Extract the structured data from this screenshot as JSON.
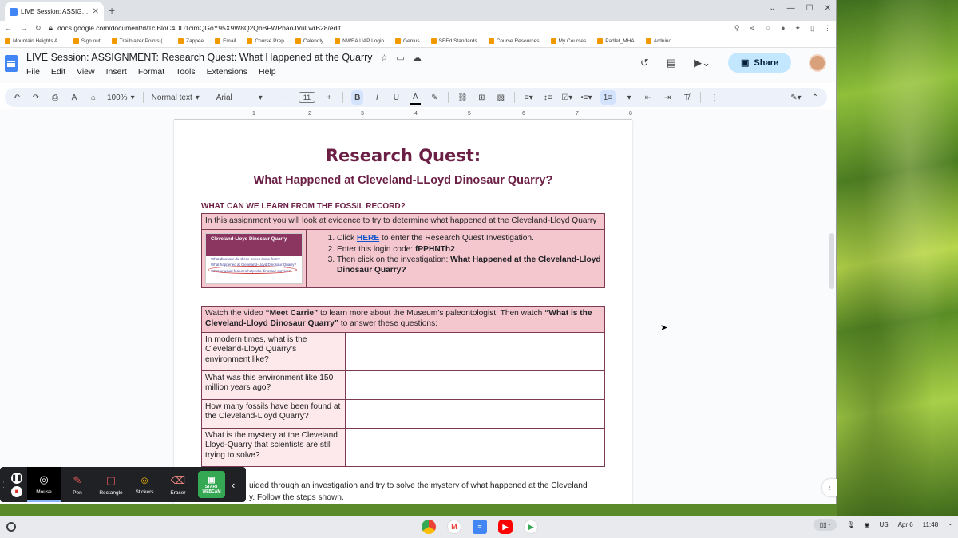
{
  "browser": {
    "tab_title": "LIVE Session: ASSIGNMENT: Re",
    "url": "docs.google.com/document/d/1ciBloC4DD1cimQGoY95X9W8Q2QbBFWPbaoJVuLwrB28/edit",
    "bookmarks": [
      "Mountain Heights A...",
      "Sign out",
      "Trailblazer Points (...",
      "Zappee",
      "Email",
      "Course Prep",
      "Calendly",
      "NWEA UAP Login",
      "Genius",
      "SEEd Standards",
      "Course Resources",
      "My Courses",
      "Padlet_MHA",
      "Arduino"
    ]
  },
  "docs": {
    "title": "LIVE Session: ASSIGNMENT: Research Quest: What Happened at the Quarry",
    "menus": [
      "File",
      "Edit",
      "View",
      "Insert",
      "Format",
      "Tools",
      "Extensions",
      "Help"
    ],
    "share_label": "Share",
    "zoom": "100%",
    "style": "Normal text",
    "font": "Arial",
    "font_size": "11",
    "ruler": [
      "1",
      "2",
      "3",
      "4",
      "5",
      "6",
      "7",
      "8"
    ]
  },
  "document": {
    "heading1": "Research Quest:",
    "heading2": "What Happened at Cleveland-LLoyd Dinosaur Quarry?",
    "section_heading": "WHAT CAN WE LEARN FROM THE FOSSIL RECORD?",
    "table1_header": "In this assignment you will look at evidence to try to determine what happened at the Cleveland-Lloyd Quarry",
    "thumb_title": "Cleveland-Lloyd Dinosaur Quarry",
    "thumb_lines": [
      "What dinosaur did these bones come from?",
      "What happened at Cleveland-Lloyd Dinosaur Quarry?",
      "What unusual features helped a dinosaur survive?"
    ],
    "step1_pre": "Click ",
    "step1_link": "HERE",
    "step1_post": " to enter the Research Quest Investigation.",
    "step2_pre": "Enter this login code: ",
    "step2_code": "fPPHNTh2",
    "step3_pre": "Then click on the investigation: ",
    "step3_bold": "What Happened at the Cleveland-Lloyd Dinosaur Quarry?",
    "table2_header_1": "Watch the video ",
    "table2_header_b1": "“Meet Carrie”",
    "table2_header_2": " to learn more about the Museum’s paleontologist. Then watch ",
    "table2_header_b2": "“What is the Cleveland-Lloyd Dinosaur Quarry”",
    "table2_header_3": " to answer these questions:",
    "questions": [
      "In modern times, what is the Cleveland-Lloyd Quarry’s environment like?",
      "What was this environment like 150 million years ago?",
      "How many fossils have been found at the Cleveland-Lloyd Quarry?",
      "What is the mystery at the Cleveland Lloyd-Quarry that scientists are still trying to solve?"
    ],
    "footer_para": "uided through an investigation and try to solve the mystery of what happened at the Cleveland",
    "footer_para2": "y.  Follow the steps shown."
  },
  "screencast": {
    "tools": [
      "Mouse",
      "Pen",
      "Rectangle",
      "Stickers",
      "Eraser"
    ],
    "webcam": "START WEBCAM"
  },
  "shelf": {
    "locale": "US",
    "date": "Apr 6",
    "time": "11:48"
  },
  "colors": {
    "heading": "#6b1f45",
    "table_header": "#f4c7cf",
    "question_cell": "#fde9ec",
    "share_button": "#c2e7ff"
  }
}
